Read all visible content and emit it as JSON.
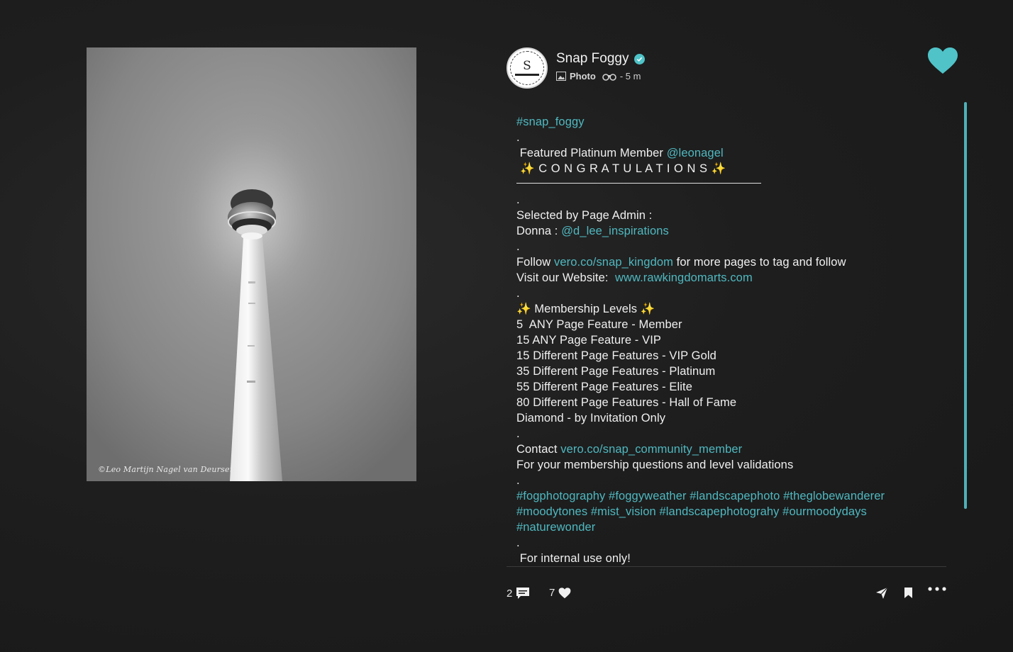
{
  "photo": {
    "watermark": "©Leo Martijn Nagel van Deursen"
  },
  "post": {
    "author": "Snap Foggy",
    "avatar_letter": "S",
    "post_type": "Photo",
    "time": "- 5 m",
    "liked": true
  },
  "caption": {
    "l1": "#snap_foggy",
    "l2": ".",
    "l3a": " Featured Platinum Member ",
    "l3b": "@leonagel",
    "l4": " ✨ C O N G R A T U L A T I O N S ✨",
    "l6": ".",
    "l7": "Selected by Page Admin :",
    "l8a": "Donna : ",
    "l8b": "@d_lee_inspirations",
    "l9": ".",
    "l10a": "Follow ",
    "l10b": "vero.co/snap_kingdom",
    "l10c": " for more pages to tag and follow",
    "l11a": "Visit our Website:  ",
    "l11b": "www.rawkingdomarts.com",
    "l12": ".",
    "l13": "✨ Membership Levels ✨",
    "l14": "5  ANY Page Feature - Member",
    "l15": "15 ANY Page Feature - VIP",
    "l16": "15 Different Page Features - VIP Gold",
    "l17": "35 Different Page Features - Platinum",
    "l18": "55 Different Page Features - Elite",
    "l19": "80 Different Page Features - Hall of Fame",
    "l20": "Diamond - by Invitation Only",
    "l21": ".",
    "l22a": "Contact ",
    "l22b": "vero.co/snap_community_member",
    "l23": "For your membership questions and level validations",
    "l24": ".",
    "l25": "#fogphotography #foggyweather #landscapephoto #theglobewanderer",
    "l26": "#moodytones #mist_vision #landscapephotograhy #ourmoodydays",
    "l27": "#naturewonder",
    "l28": ".",
    "l29": " For internal use only!"
  },
  "actions": {
    "comments_count": "2",
    "likes_count": "7"
  },
  "colors": {
    "accent": "#4fc3c8",
    "link": "#4fb8c0",
    "background": "#1e1e1e"
  }
}
